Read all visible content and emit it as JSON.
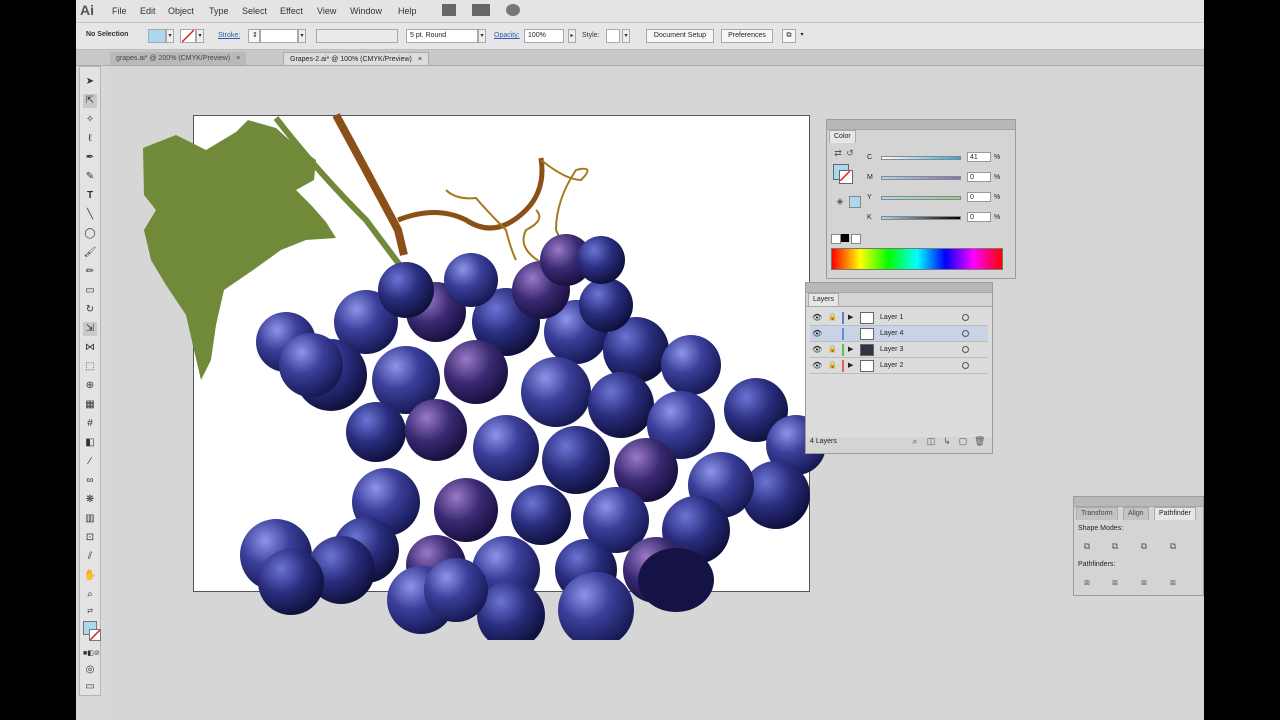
{
  "app": {
    "logo": "Ai"
  },
  "menu": [
    "File",
    "Edit",
    "Object",
    "Type",
    "Select",
    "Effect",
    "View",
    "Window",
    "Help"
  ],
  "control_bar": {
    "selection": "No Selection",
    "stroke_label": "Stroke:",
    "brush": "5 pt. Round",
    "opacity_label": "Opacity:",
    "opacity_value": "100%",
    "style_label": "Style:",
    "doc_setup": "Document Setup",
    "preferences": "Preferences"
  },
  "tabs": [
    {
      "label": "grapes.ai* @ 200% (CMYK/Preview)",
      "close": "×",
      "active": false
    },
    {
      "label": "Grapes-2.ai* @ 100% (CMYK/Preview)",
      "close": "×",
      "active": true
    }
  ],
  "color_panel": {
    "title": "Color",
    "channels": [
      {
        "label": "C",
        "value": "41",
        "unit": "%"
      },
      {
        "label": "M",
        "value": "0",
        "unit": "%"
      },
      {
        "label": "Y",
        "value": "0",
        "unit": "%"
      },
      {
        "label": "K",
        "value": "0",
        "unit": "%"
      }
    ],
    "fill_color": "#aad8f0"
  },
  "layers_panel": {
    "title": "Layers",
    "layers": [
      {
        "name": "Layer 1",
        "color": "#5a7fd8"
      },
      {
        "name": "Layer 4",
        "color": "#6a8ae0"
      },
      {
        "name": "Layer 3",
        "color": "#5cc05c"
      },
      {
        "name": "Layer 2",
        "color": "#e06060"
      }
    ],
    "footer": "4 Layers"
  },
  "pathfinder_panel": {
    "tabs": [
      "Transform",
      "Align",
      "Pathfinder"
    ],
    "shape_modes_label": "Shape Modes:",
    "pathfinders_label": "Pathfinders:"
  }
}
